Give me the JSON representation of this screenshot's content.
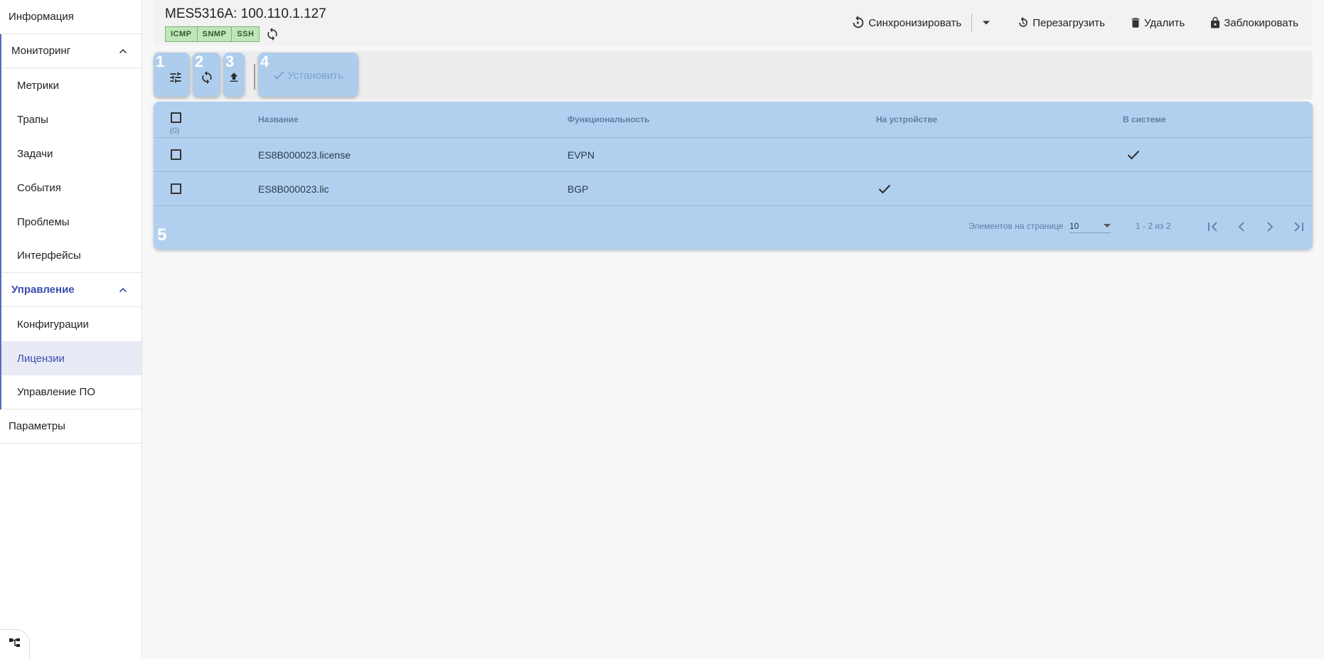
{
  "sidebar": {
    "info": "Информация",
    "monitoring": {
      "label": "Мониторинг",
      "items": [
        "Метрики",
        "Трапы",
        "Задачи",
        "События",
        "Проблемы",
        "Интерфейсы"
      ]
    },
    "management": {
      "label": "Управление",
      "items": [
        "Конфигурации",
        "Лицензии",
        "Управление ПО"
      ],
      "selected": "Лицензии"
    },
    "params": "Параметры"
  },
  "header": {
    "title": "MES5316A: 100.110.1.127",
    "badges": [
      "ICMP",
      "SNMP",
      "SSH"
    ],
    "actions": {
      "sync": "Синхронизировать",
      "reboot": "Перезагрузить",
      "delete": "Удалить",
      "lock": "Заблокировать"
    }
  },
  "toolbar": {
    "labels": [
      "1",
      "2",
      "3",
      "4"
    ],
    "install": "Установить"
  },
  "table": {
    "selected_count": "(0)",
    "columns": [
      "Название",
      "Функциональность",
      "На устройстве",
      "В системе"
    ],
    "rows": [
      {
        "name": "ES8B000023.license",
        "func": "EVPN",
        "on_device": false,
        "in_system": true
      },
      {
        "name": "ES8B000023.lic",
        "func": "BGP",
        "on_device": true,
        "in_system": false
      }
    ],
    "pager": {
      "per_page_label": "Элементов на странице",
      "per_page": "10",
      "range": "1 - 2 из 2"
    },
    "card_label": "5"
  },
  "colors": {
    "accent": "#3b4db0",
    "highlight": "#b1d0ef",
    "badge_bg": "#bfe6b8"
  }
}
